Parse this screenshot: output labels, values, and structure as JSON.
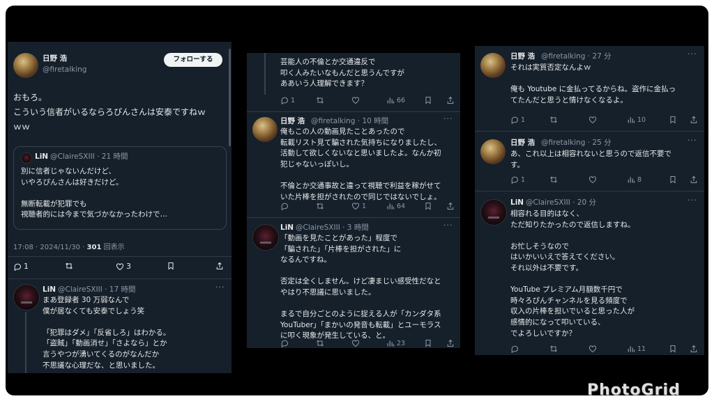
{
  "panel1": {
    "author_name": "日野 浩",
    "author_handle": "@firetalking",
    "follow_label": "フォローする",
    "text": "おもろ。\nこういう信者がいるならろぴんさんは安泰ですねｗ\nｗｗ",
    "quote": {
      "name": "LiN",
      "meta": "@ClaireSXIII · 21 時間",
      "text": "別に信者じゃないんだけど、\nいやろぴんさんは好きだけど。\n\n無断転載が犯罪でも\n視聴者的には今まで気づかなかったわけで…"
    },
    "timestamp": "17:08 · 2024/11/30 · ",
    "views_count": "301",
    "views_label": " 回表示",
    "reply_count": "1",
    "like_count": "3",
    "reply": {
      "name": "LiN",
      "meta": "@ClaireSXIII · 17 時間",
      "text": "まあ登録者 30 万弱なんで\n僕が居なくても安泰でしょう笑\n\n「犯罪はダメ」「反省しろ」はわかる。\n「盗賊」「動画消せ」「さよなら」とか\n言うやつが湧いてくるのがなんだか\n不思議な心理だな、と思いました。"
    }
  },
  "panel2": {
    "top_text": "芸能人の不倫とか交通違反で\n叩く人みたいなもんだと思うんですが\nああいう人理解できます？",
    "top_actions": {
      "reply": "1",
      "retweet": "",
      "like": "",
      "views": "66"
    },
    "tweet1": {
      "name": "日野 浩",
      "meta": "@firetalking · 10 時間",
      "text": "俺もこの人の動画見たことあったので\n転載リスト見て騙された気持ちになりましたし、\n活動して欲しくないなと思いましたよ。なんか初\n犯じゃないっぽいし。\n\n不倫とか交通事故と違って視聴で利益を稼がせて\nいた片棒を担がされたので同じではないでしょ。",
      "actions": {
        "reply": "",
        "retweet": "",
        "like": "1",
        "views": "64"
      }
    },
    "tweet2": {
      "name": "LiN",
      "meta": "@ClaireSXIII · 3 時間",
      "text": "「動画を見たことがあった」程度で\n「騙された」「片棒を担がされた」に\nなるんですね。\n\n否定は全くしません。けど凄まじい感受性だなと\nやはり不思議に思いました。\n\nまるで自分ごとのように捉える人が「カンダタ系\nYouTuber」「まかいの発音も転載」とユーモラス\nに叩く現象が発生している、と。",
      "actions": {
        "reply": "",
        "retweet": "",
        "like": "",
        "views": "23"
      }
    }
  },
  "panel3": {
    "tweet1": {
      "name": "日野 浩",
      "meta": "@firetalking · 27 分",
      "text": "それは実質否定なんよｗ\n\n俺も Youtube に金払ってるからね。盗作に金払っ\nてたんだと思うと情けなくなるよ。",
      "actions": {
        "reply": "1",
        "retweet": "",
        "like": "",
        "views": "10"
      }
    },
    "tweet2": {
      "name": "日野 浩",
      "meta": "@firetalking · 25 分",
      "text": "あ、これ以上は相容れないと思うので返信不要で\nす。",
      "actions": {
        "reply": "1",
        "retweet": "",
        "like": "",
        "views": "8"
      }
    },
    "tweet3": {
      "name": "LiN",
      "meta": "@ClaireSXIII · 20 分",
      "text": "相容れる目的はなく、\nただ知りたかったので返信しますね。\n\nお忙しそうなので\nはいかいいえで答えてください。\nそれ以外は不要です。\n\nYouTube プレミアム月額数千円で\n時々ろぴんチャンネルを見る頻度で\n収入の片棒を担いでいると思った人が\n感情的になって叩いている、\nでよろしいですか？",
      "actions": {
        "reply": "",
        "retweet": "",
        "like": "",
        "views": "11"
      }
    }
  },
  "watermark": "PhotoGrid"
}
